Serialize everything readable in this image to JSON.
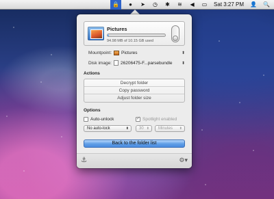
{
  "menubar": {
    "items": [
      {
        "name": "lock-icon",
        "glyph": "🔒"
      },
      {
        "name": "globe-icon",
        "glyph": "●"
      },
      {
        "name": "location-icon",
        "glyph": "➤"
      },
      {
        "name": "time-machine-icon",
        "glyph": "◷"
      },
      {
        "name": "bluetooth-icon",
        "glyph": "✱"
      },
      {
        "name": "wifi-icon",
        "glyph": "≋"
      },
      {
        "name": "volume-icon",
        "glyph": "◀"
      },
      {
        "name": "battery-icon",
        "glyph": "▭"
      }
    ],
    "clock": "Sat 3:27 PM",
    "user_glyph": "👤",
    "spotlight_glyph": "🔍"
  },
  "popover": {
    "volume": {
      "name": "Pictures",
      "usage_text": "94.98 MB of 10.15 GB used",
      "usage_fraction": 0.01
    },
    "mountpoint": {
      "label": "Mountpoint:",
      "value": "Pictures"
    },
    "disk_image": {
      "label": "Disk image:",
      "value": "26206475-F...parsebundle"
    },
    "actions": {
      "title": "Actions",
      "buttons": [
        "Decrypt folder",
        "Copy password",
        "Adjust folder size"
      ]
    },
    "options": {
      "title": "Options",
      "auto_unlock": {
        "label": "Auto-unlock",
        "checked": false
      },
      "spotlight": {
        "label": "Spotlight enabled",
        "checked": true,
        "enabled": false
      },
      "auto_lock": {
        "value": "No auto-lock"
      },
      "interval": {
        "value": "30"
      },
      "unit": {
        "value": "Minutes"
      }
    },
    "back_button": "Back to the folder list",
    "footer": {
      "anchor_glyph": "⚓",
      "gear_glyph": "⚙▾"
    }
  },
  "colors": {
    "accent": "#4a8be0",
    "menubar_bg": "#e6e6e6",
    "popover_bg": "#ececec"
  }
}
